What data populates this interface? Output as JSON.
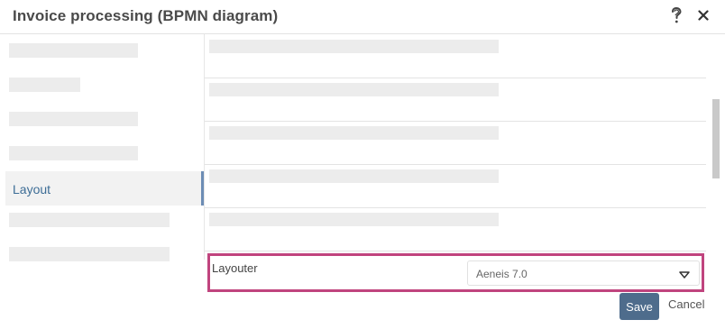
{
  "dialog": {
    "title": "Invoice processing (BPMN diagram)",
    "help_icon": "help-question-icon",
    "close_icon": "close-x-icon"
  },
  "sidebar": {
    "active_item": {
      "label": "Layout"
    },
    "active_accent_color": "#6d8db5"
  },
  "layouter": {
    "label": "Layouter",
    "selected_value": "Aeneis 7.0",
    "highlight_color": "#c0447e",
    "caret_icon": "chevron-down-icon"
  },
  "footer": {
    "save_label": "Save",
    "cancel_label": "Cancel",
    "save_color": "#4e6c8c"
  }
}
